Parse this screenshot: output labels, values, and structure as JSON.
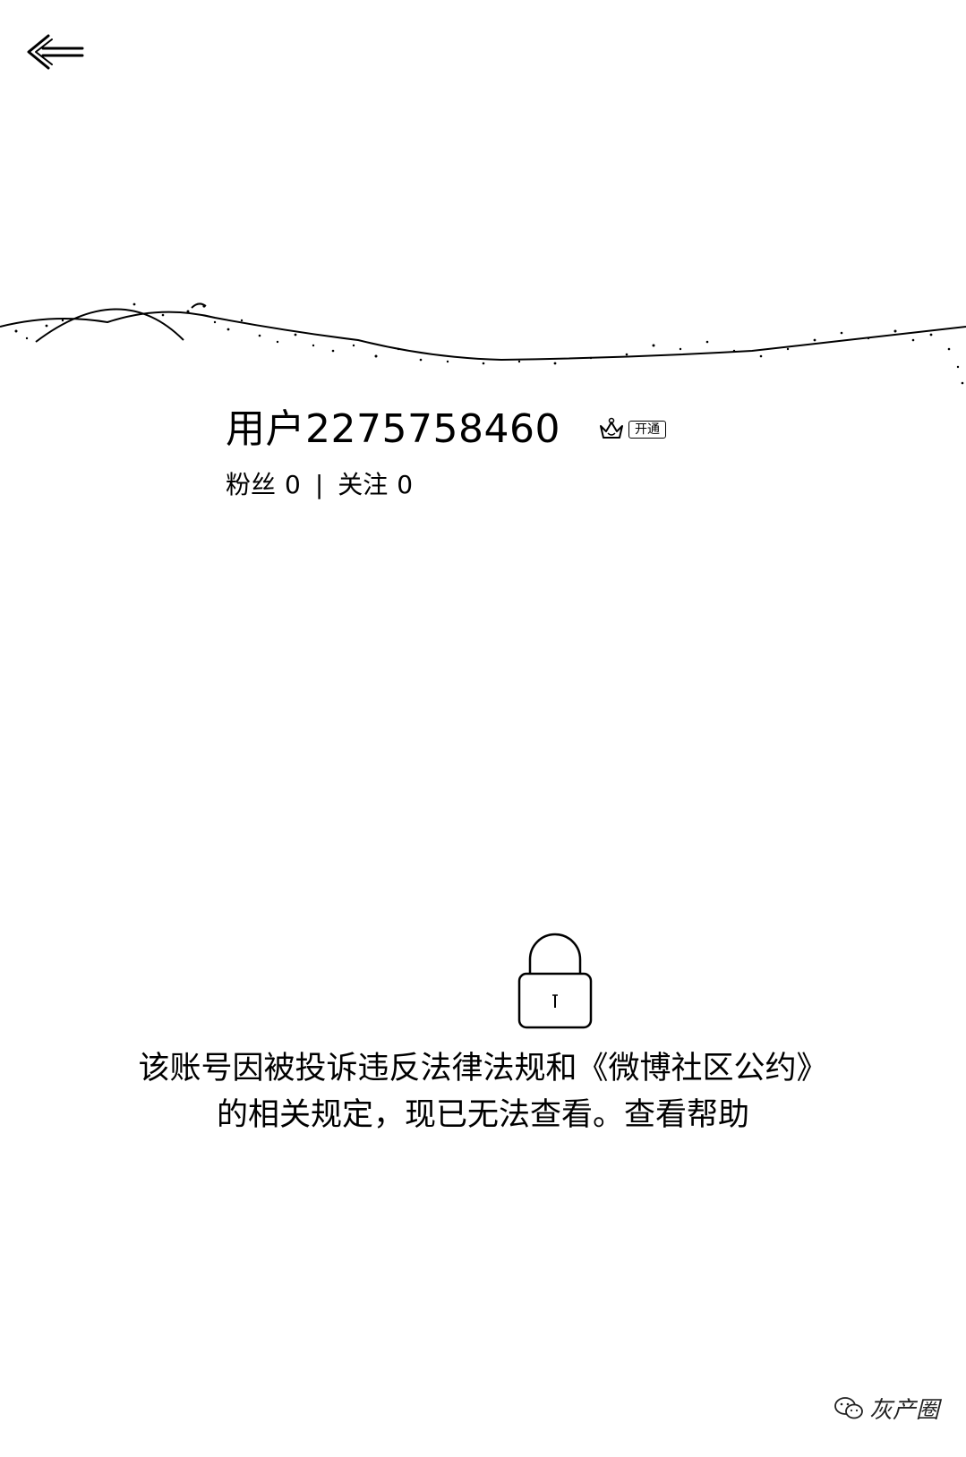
{
  "nav": {
    "back_icon": "back-arrow-icon"
  },
  "profile": {
    "username": "用户2275758460",
    "vip_label": "开通",
    "vip_icon": "vip-crown-icon",
    "fans_label": "粉丝",
    "fans_count": "0",
    "separator": "|",
    "following_label": "关注",
    "following_count": "0"
  },
  "notice": {
    "lock_icon": "lock-icon",
    "line1": "该账号因被投诉违反法律法规和《微博社区公约》",
    "line2_text": "的相关规定，现已无法查看。",
    "help_link": "查看帮助"
  },
  "watermark": {
    "text": "灰产圈",
    "icon": "wechat-icon"
  }
}
